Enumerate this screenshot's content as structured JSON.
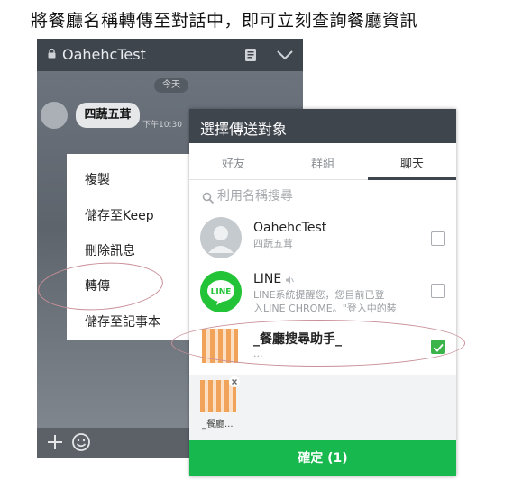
{
  "caption": "將餐廳名稱轉傳至對話中，即可立刻查詢餐廳資訊",
  "chat": {
    "title": "OahehcTest",
    "date_label": "今天",
    "message_text": "四蔬五茸",
    "message_time": "下午10:30",
    "context_menu": [
      "複製",
      "儲存至Keep",
      "刪除訊息",
      "轉傳",
      "儲存至記事本"
    ]
  },
  "share_panel": {
    "title": "選擇傳送對象",
    "tabs": [
      "好友",
      "群組",
      "聊天"
    ],
    "active_tab": "聊天",
    "search_placeholder": "利用名稱搜尋",
    "items": [
      {
        "name": "OahehcTest",
        "subtitle": "四蔬五茸",
        "checked": false
      },
      {
        "name": "LINE",
        "subtitle_line1": "LINE系統提醒您，您目前已登",
        "subtitle_line2": "入LINE CHROME。\"登入中的裝",
        "checked": false,
        "avatar_label": "LINE"
      },
      {
        "name": "_餐廳搜尋助手_",
        "subtitle": "...",
        "checked": true
      }
    ],
    "selected_label": "_餐廳...",
    "confirm_label": "確定 (1)"
  },
  "colors": {
    "header_dark": "#3f454d",
    "line_green": "#17b84d",
    "checkbox_green": "#3bb54a",
    "highlight_oval": "#c98f98"
  },
  "icons": [
    "lock-icon",
    "notes-icon",
    "chevron-down-icon",
    "search-icon",
    "plus-icon",
    "smile-icon",
    "remove-icon",
    "mute-icon"
  ]
}
